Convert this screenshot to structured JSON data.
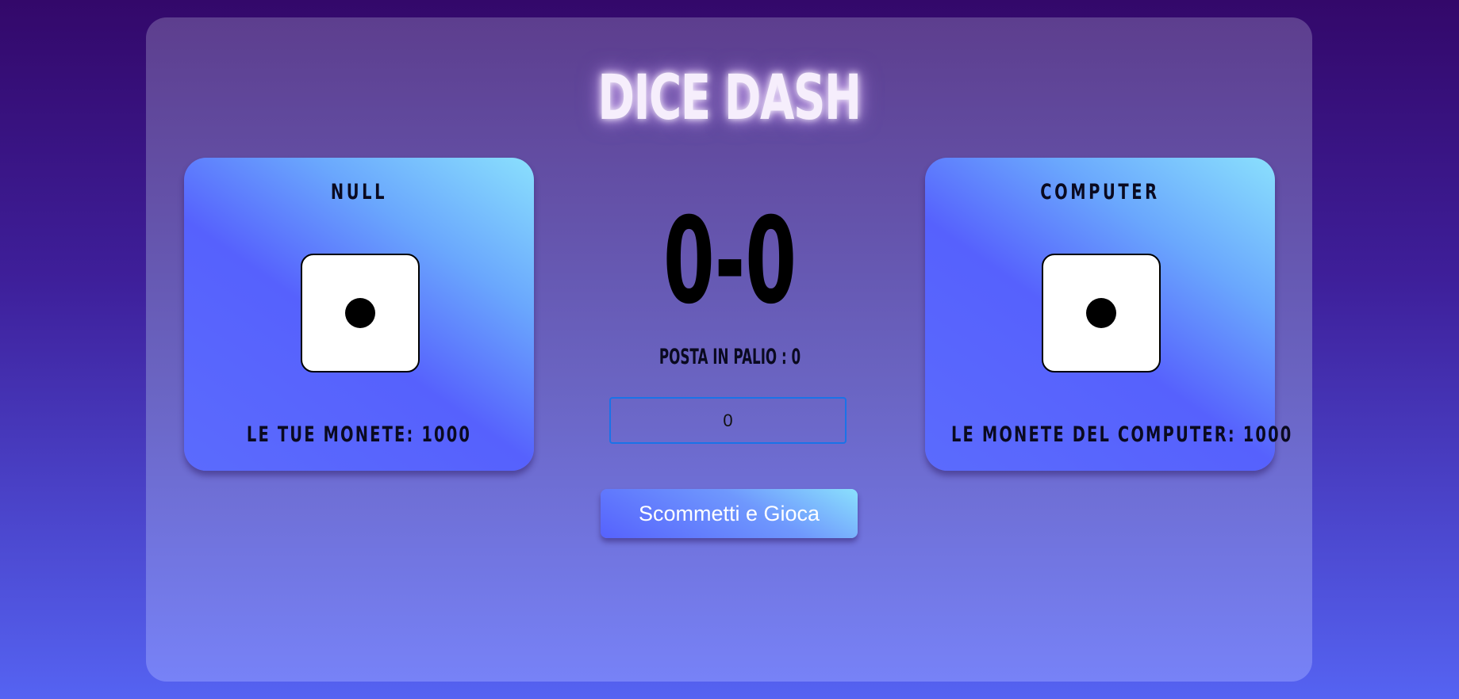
{
  "title": "DICE DASH",
  "player": {
    "name": "NULL",
    "die_face": 1,
    "coins_label": "LE TUE MONETE: 1000"
  },
  "computer": {
    "name": "COMPUTER",
    "die_face": 1,
    "coins_label": "LE MONETE DEL COMPUTER: 1000"
  },
  "score": "0-0",
  "stake_label": "POSTA IN PALIO : 0",
  "bet_input": {
    "value": "0"
  },
  "play_button_label": "Scommetti e Gioca",
  "colors": {
    "background_top": "#33086a",
    "background_bottom": "#5563f2",
    "card_light": "#8ae0fd",
    "card_dark": "#5661fd",
    "title_glow": "#e6beff",
    "input_border": "#1a73e8"
  }
}
